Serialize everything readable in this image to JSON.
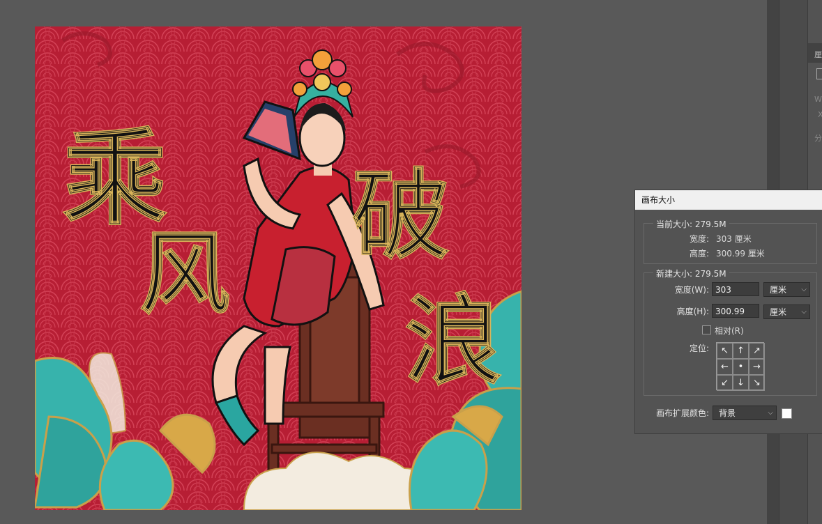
{
  "artwork": {
    "title_chars": [
      "乘",
      "风",
      "破",
      "浪"
    ]
  },
  "right_panel": {
    "label_1": "厘",
    "label_w": "W",
    "label_x": "X",
    "label_fen": "分"
  },
  "dialog": {
    "title": "画布大小",
    "current": {
      "legend": "当前大小: 279.5M",
      "width_label": "宽度:",
      "width_value": "303 厘米",
      "height_label": "高度:",
      "height_value": "300.99 厘米"
    },
    "new": {
      "legend": "新建大小: 279.5M",
      "width_label": "宽度(W):",
      "width_value": "303",
      "width_unit": "厘米",
      "height_label": "高度(H):",
      "height_value": "300.99",
      "height_unit": "厘米",
      "relative_label": "相对(R)",
      "relative_checked": false,
      "anchor_label": "定位:",
      "anchor_arrows": [
        "↖",
        "↑",
        "↗",
        "←",
        "•",
        "→",
        "↙",
        "↓",
        "↘"
      ]
    },
    "ext_color_label": "画布扩展颜色:",
    "ext_color_value": "背景",
    "ext_color_swatch": "#ffffff"
  }
}
